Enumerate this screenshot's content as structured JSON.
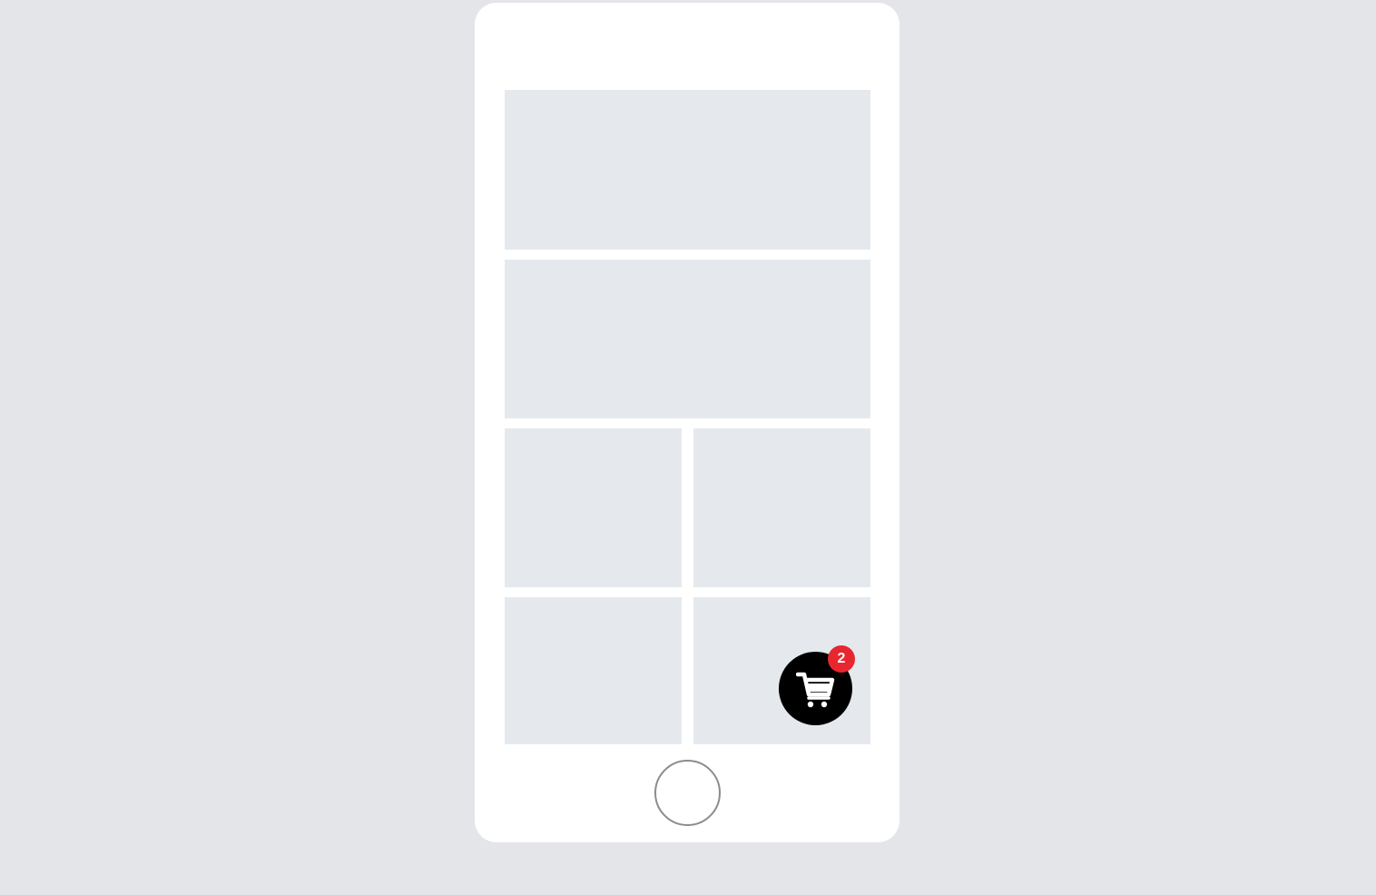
{
  "cart": {
    "badge_count": "2",
    "icon": "shopping-cart-icon",
    "badge_color": "#e8262f",
    "button_color": "#000000"
  },
  "colors": {
    "background": "#e3e5e9",
    "phone": "#ffffff",
    "placeholder_card": "#e5e9ed",
    "home_button_border": "#8c8c8c"
  }
}
